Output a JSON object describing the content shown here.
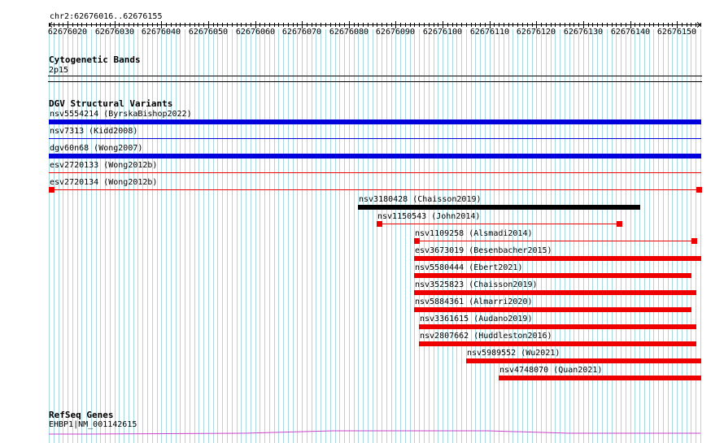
{
  "region": {
    "label": "chr2:62676016..62676155",
    "start": 62676016,
    "end": 62676155,
    "ticks": [
      62676020,
      62676030,
      62676040,
      62676050,
      62676060,
      62676070,
      62676080,
      62676090,
      62676100,
      62676110,
      62676120,
      62676130,
      62676140,
      62676150
    ]
  },
  "tracks": {
    "cytoband": {
      "title": "Cytogenetic Bands",
      "band": "2p15"
    },
    "dgv": {
      "title": "DGV Structural Variants",
      "colors": {
        "blue": "#0000dd",
        "red": "#ee0000",
        "black": "#000000"
      },
      "features": [
        {
          "label": "nsv5554214 (ByrskaBishop2022)",
          "start": 62676016,
          "end": 62676155,
          "color": "blue",
          "style": "thick"
        },
        {
          "label": "nsv7313 (Kidd2008)",
          "start": 62676016,
          "end": 62676155,
          "color": "blue",
          "style": "thin"
        },
        {
          "label": "dgv60n68 (Wong2007)",
          "start": 62676016,
          "end": 62676155,
          "color": "blue",
          "style": "thick"
        },
        {
          "label": "esv2720133 (Wong2012b)",
          "start": 62676016,
          "end": 62676155,
          "color": "red",
          "style": "thin"
        },
        {
          "label": "esv2720134 (Wong2012b)",
          "start": 62676016,
          "end": 62676155,
          "color": "red",
          "style": "capped"
        },
        {
          "label": "nsv3180428 (Chaisson2019)",
          "start": 62676082,
          "end": 62676142,
          "color": "black",
          "style": "thick"
        },
        {
          "label": "nsv1150543 (John2014)",
          "start": 62676086,
          "end": 62676138,
          "color": "red",
          "style": "capped"
        },
        {
          "label": "nsv1109258 (Alsmadi2014)",
          "start": 62676094,
          "end": 62676154,
          "color": "red",
          "style": "capped"
        },
        {
          "label": "esv3673019 (Besenbacher2015)",
          "start": 62676094,
          "end": 62676155,
          "color": "red",
          "style": "thick"
        },
        {
          "label": "nsv5580444 (Ebert2021)",
          "start": 62676094,
          "end": 62676153,
          "color": "red",
          "style": "thick"
        },
        {
          "label": "nsv3525823 (Chaisson2019)",
          "start": 62676094,
          "end": 62676154,
          "color": "red",
          "style": "thick"
        },
        {
          "label": "nsv5884361 (Almarri2020)",
          "start": 62676094,
          "end": 62676153,
          "color": "red",
          "style": "thick"
        },
        {
          "label": "nsv3361615 (Audano2019)",
          "start": 62676095,
          "end": 62676154,
          "color": "red",
          "style": "thick"
        },
        {
          "label": "nsv2807662 (Huddleston2016)",
          "start": 62676095,
          "end": 62676154,
          "color": "red",
          "style": "thick"
        },
        {
          "label": "nsv5989552 (Wu2021)",
          "start": 62676105,
          "end": 62676155,
          "color": "red",
          "style": "thick"
        },
        {
          "label": "nsv4748070 (Quan2021)",
          "start": 62676112,
          "end": 62676155,
          "color": "red",
          "style": "thick"
        }
      ]
    },
    "refseq": {
      "title": "RefSeq Genes",
      "gene": "EHBP1|NM_001142615",
      "color": "#cc44cc"
    }
  },
  "grid_color": "#a8d8e0"
}
